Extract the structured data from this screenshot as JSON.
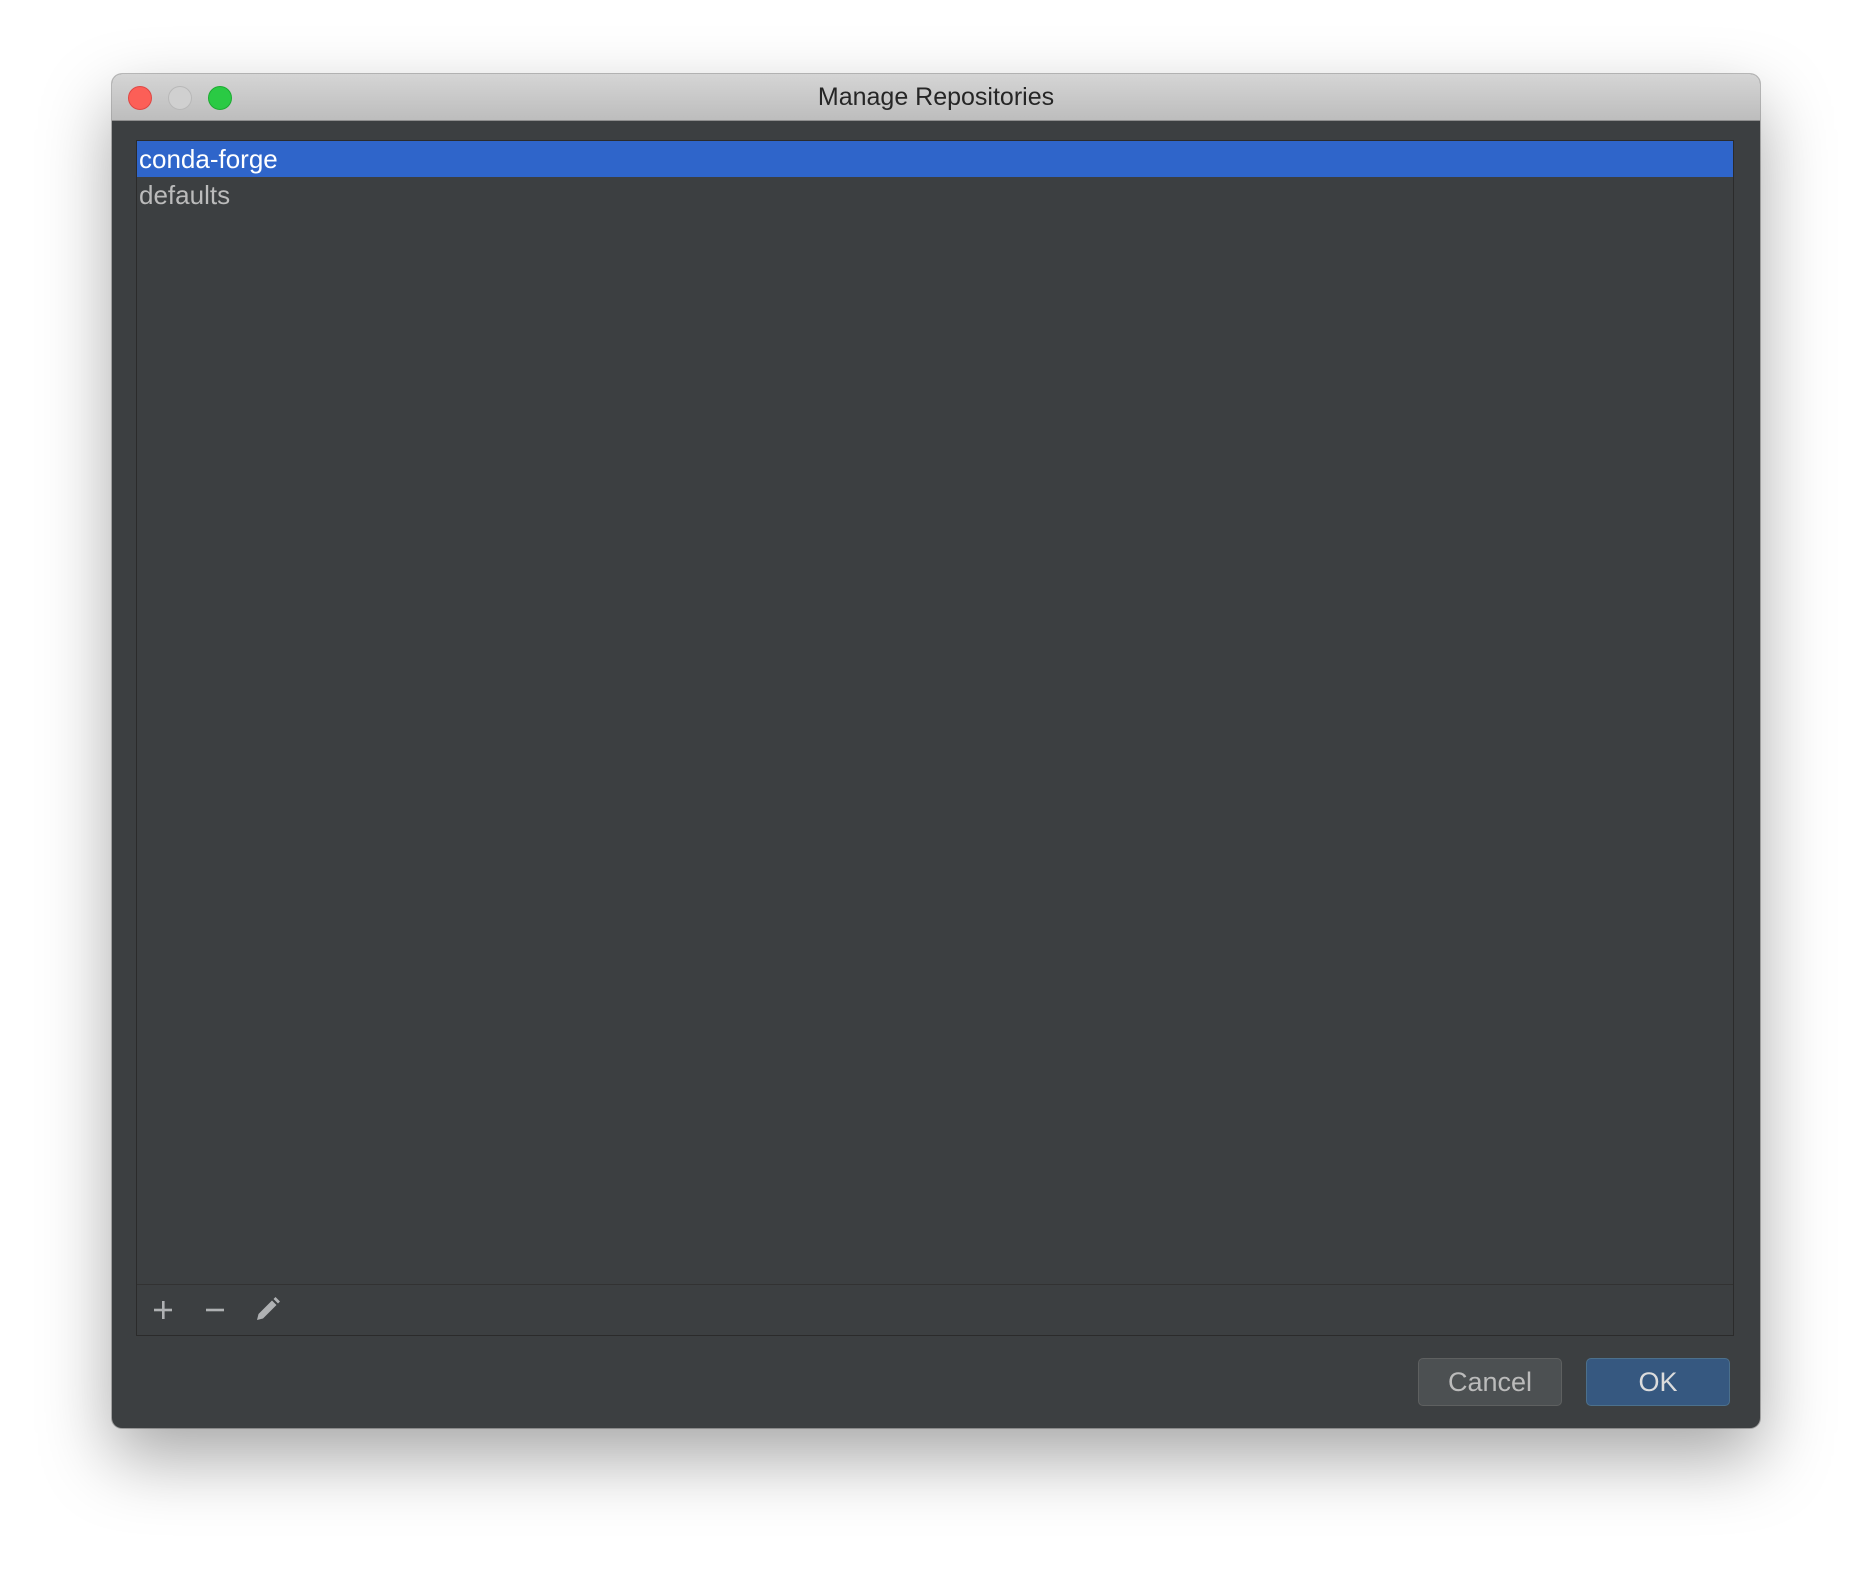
{
  "window": {
    "title": "Manage Repositories"
  },
  "repositories": {
    "items": [
      {
        "label": "conda-forge",
        "selected": true
      },
      {
        "label": "defaults",
        "selected": false
      }
    ]
  },
  "toolbar": {
    "add_icon": "plus-icon",
    "remove_icon": "minus-icon",
    "edit_icon": "pencil-icon"
  },
  "buttons": {
    "cancel_label": "Cancel",
    "ok_label": "OK"
  },
  "colors": {
    "selection": "#2f65ca",
    "background": "#3c3f41",
    "ok_button": "#365880"
  }
}
